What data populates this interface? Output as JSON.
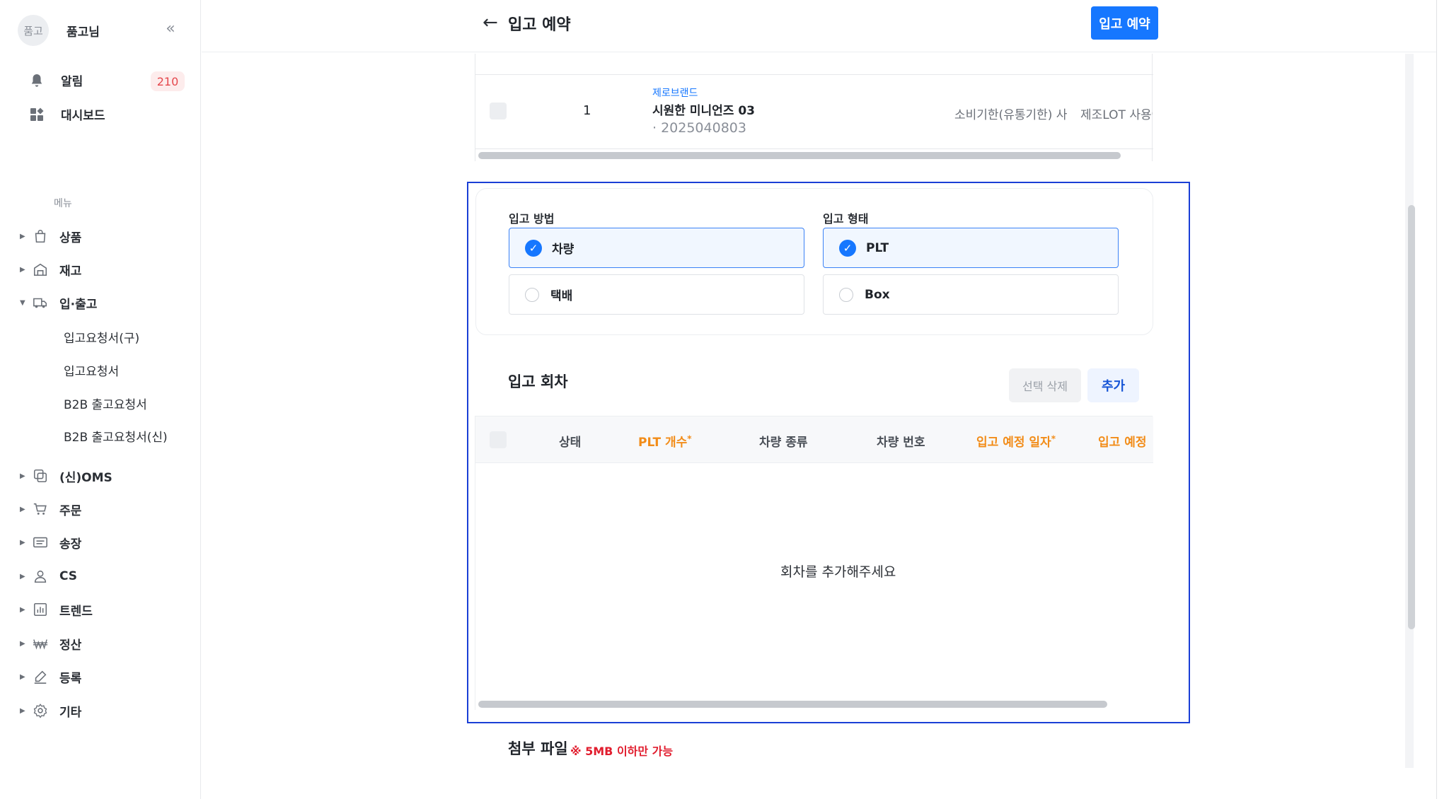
{
  "sidebar": {
    "avatar_text": "품고",
    "user_name": "품고님",
    "collapse_icon": "double-chevron-left-icon",
    "alerts_label": "알림",
    "alerts_count": "210",
    "dashboard_label": "대시보드",
    "menu_heading": "메뉴",
    "nav": [
      {
        "label": "상품",
        "icon": "bag-icon"
      },
      {
        "label": "재고",
        "icon": "warehouse-icon"
      },
      {
        "label": "입·출고",
        "icon": "truck-icon",
        "expanded": true
      },
      {
        "label": "(신)OMS",
        "icon": "oms-icon"
      },
      {
        "label": "주문",
        "icon": "cart-icon"
      },
      {
        "label": "송장",
        "icon": "invoice-icon"
      },
      {
        "label": "CS",
        "icon": "person-icon"
      },
      {
        "label": "트렌드",
        "icon": "chart-icon"
      },
      {
        "label": "정산",
        "icon": "won-icon"
      },
      {
        "label": "등록",
        "icon": "pencil-icon"
      },
      {
        "label": "기타",
        "icon": "gear-icon"
      }
    ],
    "sub_items": [
      "입고요청서(구)",
      "입고요청서",
      "B2B 출고요청서",
      "B2B 출고요청서(신)"
    ]
  },
  "header": {
    "back_icon": "←",
    "title": "입고 예약",
    "primary_button": "입고 예약"
  },
  "product_row": {
    "index": "1",
    "brand": "제로브랜드",
    "name": "시원한 미니언즈 03",
    "code": "· 2025040803",
    "expiry_col": "소비기한(유통기한) 사",
    "lot_col": "제조LOT 사용여부"
  },
  "inbound": {
    "method_label": "입고 방법",
    "method_options": [
      {
        "label": "차량",
        "selected": true
      },
      {
        "label": "택배",
        "selected": false
      }
    ],
    "type_label": "입고 형태",
    "type_options": [
      {
        "label": "PLT",
        "selected": true
      },
      {
        "label": "Box",
        "selected": false
      }
    ]
  },
  "rounds": {
    "title": "입고 회차",
    "delete_button": "선택 삭제",
    "add_button": "추가",
    "columns": [
      {
        "label": "상태",
        "required": false
      },
      {
        "label": "PLT 개수",
        "required": true
      },
      {
        "label": "차량 종류",
        "required": false
      },
      {
        "label": "차량 번호",
        "required": false
      },
      {
        "label": "입고 예정 일자",
        "required": true
      },
      {
        "label": "입고 예정",
        "required": true
      }
    ],
    "required_mark": "*",
    "empty_message": "회차를 추가해주세요"
  },
  "attachment": {
    "title": "첨부 파일",
    "note": "※ 5MB 이하만 가능"
  },
  "colors": {
    "accent": "#1677ff",
    "required": "#f28c18",
    "highlight_border": "#1a3fd6",
    "badge_bg": "#fdecec",
    "badge_text": "#e5484d",
    "warning_text": "#e11d2e"
  }
}
